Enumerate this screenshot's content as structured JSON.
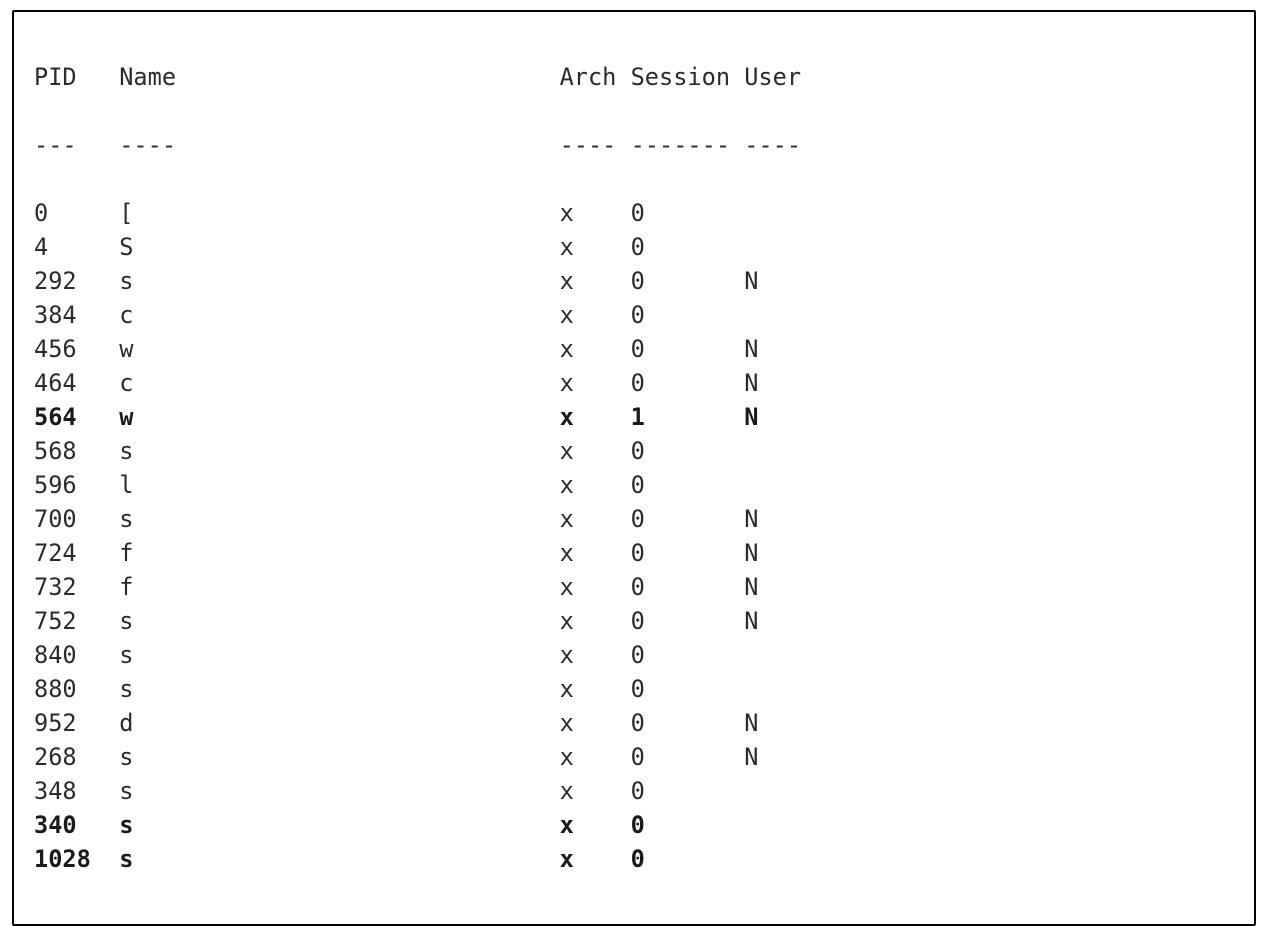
{
  "table": {
    "columns": {
      "pid": "PID",
      "name": "Name",
      "arch": "Arch",
      "session": "Session",
      "user": "User"
    },
    "underline": {
      "pid": "---",
      "name": "----",
      "arch": "----",
      "session": "-------",
      "user": "----"
    },
    "rows": [
      {
        "pid": "0",
        "name": "[",
        "arch": "x",
        "session": "0",
        "user": "",
        "bold": false
      },
      {
        "pid": "4",
        "name": "S",
        "arch": "x",
        "session": "0",
        "user": "",
        "bold": false
      },
      {
        "pid": "292",
        "name": "s",
        "arch": "x",
        "session": "0",
        "user": "N",
        "bold": false
      },
      {
        "pid": "384",
        "name": "c",
        "arch": "x",
        "session": "0",
        "user": "",
        "bold": false
      },
      {
        "pid": "456",
        "name": "w",
        "arch": "x",
        "session": "0",
        "user": "N",
        "bold": false
      },
      {
        "pid": "464",
        "name": "c",
        "arch": "x",
        "session": "0",
        "user": "N",
        "bold": false
      },
      {
        "pid": "564",
        "name": "w",
        "arch": "x",
        "session": "1",
        "user": "N",
        "bold": true
      },
      {
        "pid": "568",
        "name": "s",
        "arch": "x",
        "session": "0",
        "user": "",
        "bold": false
      },
      {
        "pid": "596",
        "name": "l",
        "arch": "x",
        "session": "0",
        "user": "",
        "bold": false
      },
      {
        "pid": "700",
        "name": "s",
        "arch": "x",
        "session": "0",
        "user": "N",
        "bold": false
      },
      {
        "pid": "724",
        "name": "f",
        "arch": "x",
        "session": "0",
        "user": "N",
        "bold": false
      },
      {
        "pid": "732",
        "name": "f",
        "arch": "x",
        "session": "0",
        "user": "N",
        "bold": false
      },
      {
        "pid": "752",
        "name": "s",
        "arch": "x",
        "session": "0",
        "user": "N",
        "bold": false
      },
      {
        "pid": "840",
        "name": "s",
        "arch": "x",
        "session": "0",
        "user": "",
        "bold": false
      },
      {
        "pid": "880",
        "name": "s",
        "arch": "x",
        "session": "0",
        "user": "",
        "bold": false
      },
      {
        "pid": "952",
        "name": "d",
        "arch": "x",
        "session": "0",
        "user": "N",
        "bold": false
      },
      {
        "pid": "268",
        "name": "s",
        "arch": "x",
        "session": "0",
        "user": "N",
        "bold": false
      },
      {
        "pid": "348",
        "name": "s",
        "arch": "x",
        "session": "0",
        "user": "",
        "bold": false
      },
      {
        "pid": "340",
        "name": "s",
        "arch": "x",
        "session": "0",
        "user": "",
        "bold": true
      },
      {
        "pid": "1028",
        "name": "s",
        "arch": "x",
        "session": "0",
        "user": "",
        "bold": true
      }
    ]
  },
  "widths": {
    "pid": 6,
    "name": 31,
    "arch": 5,
    "session": 8,
    "user": 6
  }
}
